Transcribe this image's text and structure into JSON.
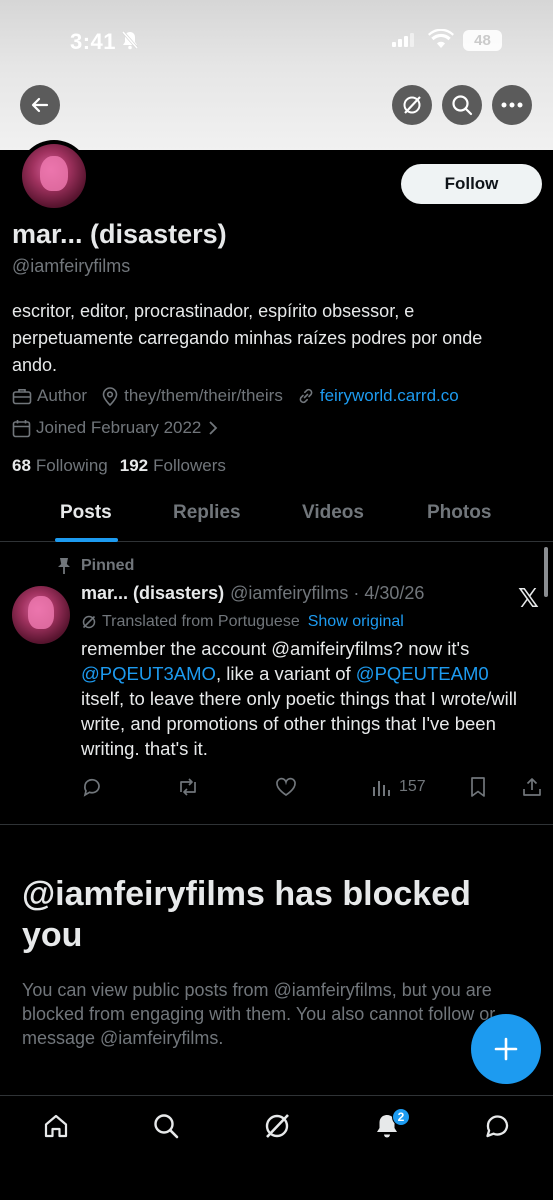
{
  "status_bar": {
    "time": "3:41",
    "battery": "48"
  },
  "profile": {
    "display_name": "mar... (disasters)",
    "handle": "@iamfeiryfilms",
    "follow_label": "Follow",
    "bio": "escritor, editor, procrastinador, espírito obsessor, e perpetuamente carregando minhas raízes podres por onde ando.",
    "category": "Author",
    "pronouns": "they/them/their/theirs",
    "website": "feiryworld.carrd.co",
    "joined": "Joined February 2022",
    "following_count": "68",
    "following_label": "Following",
    "followers_count": "192",
    "followers_label": "Followers"
  },
  "tabs": [
    {
      "label": "Posts"
    },
    {
      "label": "Replies"
    },
    {
      "label": "Videos"
    },
    {
      "label": "Photos"
    }
  ],
  "post": {
    "pinned_label": "Pinned",
    "author_name": "mar... (disasters)",
    "author_handle": "@iamfeiryfilms",
    "date": "4/30/26",
    "translated_label": "Translated from Portuguese",
    "show_original": "Show original",
    "text_1": "remember the account @amifeiryfilms? now it's ",
    "mention_1": "@PQEUT3AMO",
    "text_2": ", like a variant of ",
    "mention_2": "@PQEUTEAM0",
    "text_3": " itself, to leave there only poetic things that I wrote/will write, and promotions of other things that I've been writing. that's it.",
    "views": "157"
  },
  "blocked": {
    "title": "@iamfeiryfilms has blocked you",
    "message": "You can view public posts from @iamfeiryfilms, but you are blocked from engaging with them. You also cannot follow or message @iamfeiryfilms."
  },
  "nav": {
    "notification_count": "2"
  },
  "colors": {
    "accent": "#1d9bf0",
    "background": "#000000",
    "muted": "#71767b"
  }
}
